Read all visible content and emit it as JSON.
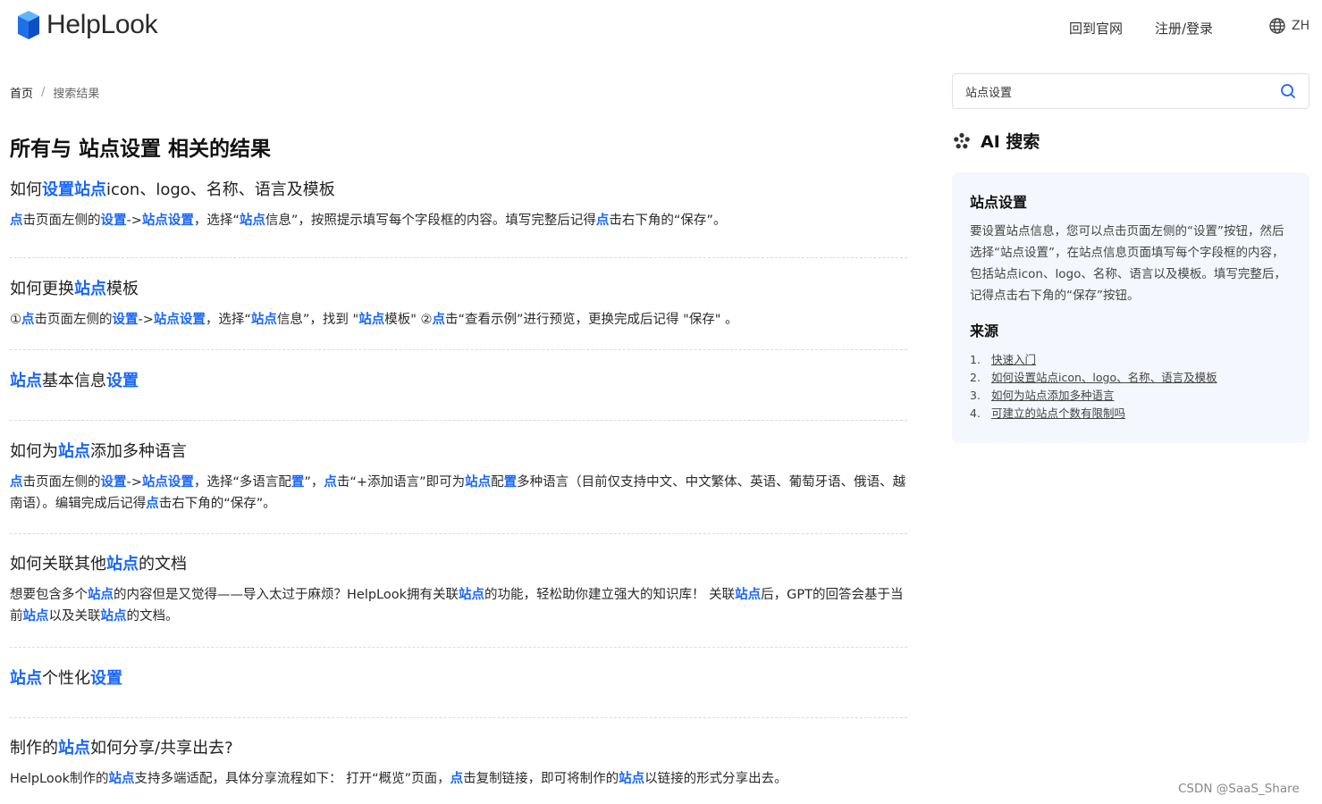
{
  "header": {
    "logo_text": "HelpLook",
    "nav_home": "回到官网",
    "nav_login": "注册/登录",
    "lang": "ZH"
  },
  "breadcrumb": {
    "home": "首页",
    "sep": "/",
    "current": "搜索结果"
  },
  "page_title": "所有与 站点设置 相关的结果",
  "results": [
    {
      "title": [
        [
          "如何",
          false
        ],
        [
          "设置站点",
          true
        ],
        [
          "icon、logo、名称、语言及模板",
          false
        ]
      ],
      "desc": [
        [
          "点",
          true
        ],
        [
          "击页面左侧的",
          false
        ],
        [
          "设置",
          true
        ],
        [
          "->",
          false
        ],
        [
          "站点设置",
          true
        ],
        [
          "，选择“",
          false
        ],
        [
          "站点",
          true
        ],
        [
          "信息”，按照提示填写每个字段框的内容。填写完整后记得",
          false
        ],
        [
          "点",
          true
        ],
        [
          "击右下角的“保存”。",
          false
        ]
      ]
    },
    {
      "title": [
        [
          "如何更换",
          false
        ],
        [
          "站点",
          true
        ],
        [
          "模板",
          false
        ]
      ],
      "desc": [
        [
          "①",
          false
        ],
        [
          "点",
          true
        ],
        [
          "击页面左侧的",
          false
        ],
        [
          "设置",
          true
        ],
        [
          "->",
          false
        ],
        [
          "站点设置",
          true
        ],
        [
          "，选择“",
          false
        ],
        [
          "站点",
          true
        ],
        [
          "信息”，找到 \"",
          false
        ],
        [
          "站点",
          true
        ],
        [
          "模板\" ②",
          false
        ],
        [
          "点",
          true
        ],
        [
          "击“查看示例”进行预览，更换完成后记得 \"保存\" 。",
          false
        ]
      ]
    },
    {
      "title": [
        [
          "站点",
          true
        ],
        [
          "基本信息",
          false
        ],
        [
          "设置",
          true
        ]
      ],
      "desc": []
    },
    {
      "title": [
        [
          "如何为",
          false
        ],
        [
          "站点",
          true
        ],
        [
          "添加多种语言",
          false
        ]
      ],
      "desc": [
        [
          "点",
          true
        ],
        [
          "击页面左侧的",
          false
        ],
        [
          "设置",
          true
        ],
        [
          "->",
          false
        ],
        [
          "站点设置",
          true
        ],
        [
          "，选择“多语言配",
          false
        ],
        [
          "置",
          true
        ],
        [
          "”，",
          false
        ],
        [
          "点",
          true
        ],
        [
          "击“+添加语言”即可为",
          false
        ],
        [
          "站点",
          true
        ],
        [
          "配",
          false
        ],
        [
          "置",
          true
        ],
        [
          "多种语言（目前仅支持中文、中文繁体、英语、葡萄牙语、俄语、越南语）。编辑完成后记得",
          false
        ],
        [
          "点",
          true
        ],
        [
          "击右下角的“保存”。",
          false
        ]
      ]
    },
    {
      "title": [
        [
          "如何关联其他",
          false
        ],
        [
          "站点",
          true
        ],
        [
          "的文档",
          false
        ]
      ],
      "desc": [
        [
          "想要包含多个",
          false
        ],
        [
          "站点",
          true
        ],
        [
          "的内容但是又觉得——导入太过于麻烦？HelpLook拥有关联",
          false
        ],
        [
          "站点",
          true
        ],
        [
          "的功能，轻松助你建立强大的知识库！ 关联",
          false
        ],
        [
          "站点",
          true
        ],
        [
          "后，GPT的回答会基于当前",
          false
        ],
        [
          "站点",
          true
        ],
        [
          "以及关联",
          false
        ],
        [
          "站点",
          true
        ],
        [
          "的文档。",
          false
        ]
      ]
    },
    {
      "title": [
        [
          "站点",
          true
        ],
        [
          "个性化",
          false
        ],
        [
          "设置",
          true
        ]
      ],
      "desc": []
    },
    {
      "title": [
        [
          "制作的",
          false
        ],
        [
          "站点",
          true
        ],
        [
          "如何分享/共享出去?",
          false
        ]
      ],
      "desc": [
        [
          "HelpLook制作的",
          false
        ],
        [
          "站点",
          true
        ],
        [
          "支持多端适配，具体分享流程如下： 打开“概览”页面，",
          false
        ],
        [
          "点",
          true
        ],
        [
          "击复制链接，即可将制作的",
          false
        ],
        [
          "站点",
          true
        ],
        [
          "以链接的形式分享出去。",
          false
        ]
      ]
    }
  ],
  "sidebar": {
    "search_value": "站点设置",
    "ai_heading": "AI 搜索",
    "ai_card_title": "站点设置",
    "ai_card_body": "要设置站点信息，您可以点击页面左侧的“设置”按钮，然后选择“站点设置”，在站点信息页面填写每个字段框的内容，包括站点icon、logo、名称、语言以及模板。填写完整后，记得点击右下角的“保存”按钮。",
    "sources_title": "来源",
    "sources": [
      {
        "num": "1.",
        "label": "快速入门"
      },
      {
        "num": "2.",
        "label": "如何设置站点icon、logo、名称、语言及模板"
      },
      {
        "num": "3.",
        "label": "如何为站点添加多种语言"
      },
      {
        "num": "4.",
        "label": "可建立的站点个数有限制吗"
      }
    ]
  },
  "watermark": "CSDN @SaaS_Share",
  "colors": {
    "accent": "#1a66ff",
    "card_bg": "#f4f7fd"
  },
  "icons": {
    "logo": "helplook-cube-logo",
    "lang": "globe-icon",
    "search": "search-icon",
    "ai": "ai-sparkle-icon"
  }
}
